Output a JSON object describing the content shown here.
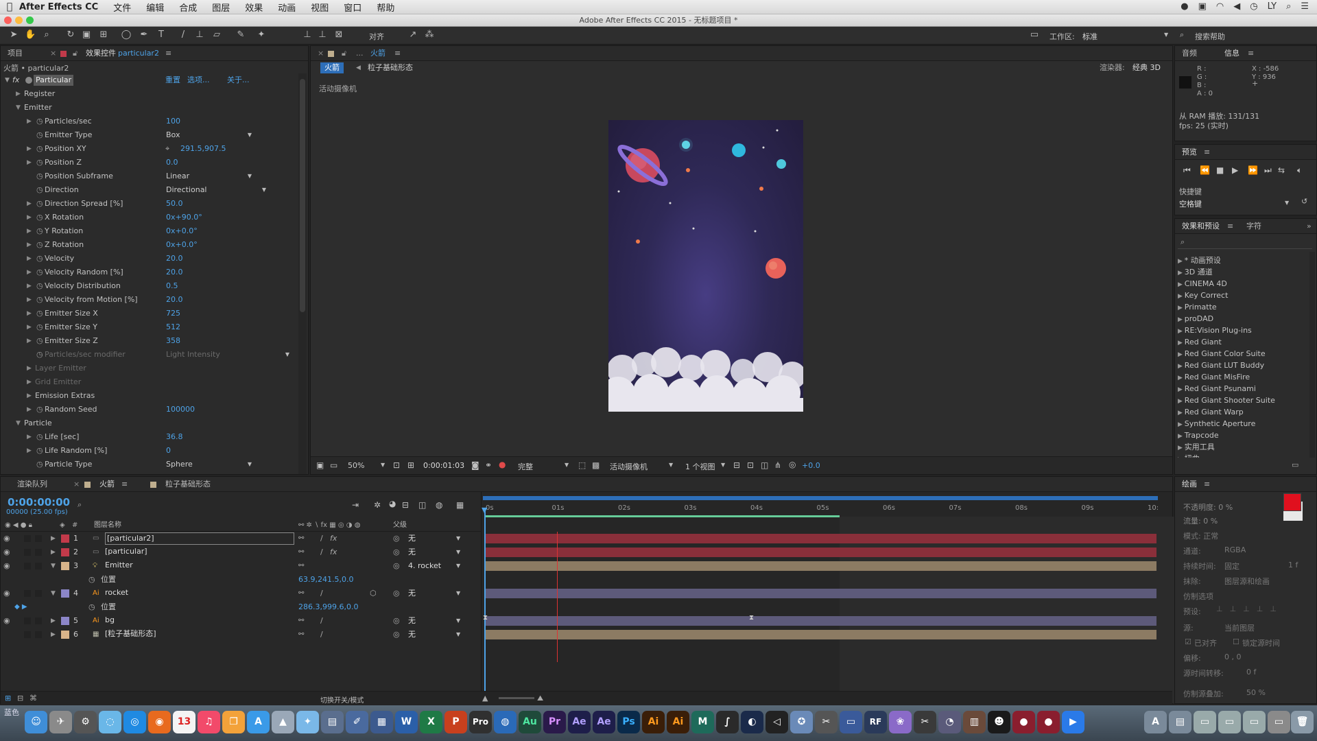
{
  "menubar": {
    "app": "After Effects CC",
    "items": [
      "文件",
      "编辑",
      "合成",
      "图层",
      "效果",
      "动画",
      "视图",
      "窗口",
      "帮助"
    ],
    "user": "LY"
  },
  "window_title": "Adobe After Effects CC 2015 - 无标题项目 *",
  "toolbar": {
    "align": "对齐",
    "workspace_label": "工作区:",
    "workspace_value": "标准",
    "search_help": "搜索帮助"
  },
  "project_panel": {
    "tab_project": "项目",
    "tab_effect_controls": "效果控件",
    "layer": "particular2",
    "breadcrumb": "火箭 • particular2",
    "effect": "Particular",
    "reset": "重置",
    "options": "选项...",
    "about": "关于..."
  },
  "props": [
    {
      "name": "Register",
      "level": 1,
      "type": "group"
    },
    {
      "name": "Emitter",
      "level": 1,
      "type": "group_open"
    },
    {
      "name": "Particles/sec",
      "level": 2,
      "val": "100"
    },
    {
      "name": "Emitter Type",
      "level": 2,
      "dd": "Box"
    },
    {
      "name": "Position XY",
      "level": 2,
      "val": "291.5,907.5",
      "pos": true
    },
    {
      "name": "Position Z",
      "level": 2,
      "val": "0.0"
    },
    {
      "name": "Position Subframe",
      "level": 2,
      "dd": "Linear"
    },
    {
      "name": "Direction",
      "level": 2,
      "dd": "Directional"
    },
    {
      "name": "Direction Spread [%]",
      "level": 2,
      "val": "50.0"
    },
    {
      "name": "X Rotation",
      "level": 2,
      "val": "0x+90.0°"
    },
    {
      "name": "Y Rotation",
      "level": 2,
      "val": "0x+0.0°"
    },
    {
      "name": "Z Rotation",
      "level": 2,
      "val": "0x+0.0°"
    },
    {
      "name": "Velocity",
      "level": 2,
      "val": "20.0"
    },
    {
      "name": "Velocity Random [%]",
      "level": 2,
      "val": "20.0"
    },
    {
      "name": "Velocity Distribution",
      "level": 2,
      "val": "0.5"
    },
    {
      "name": "Velocity from Motion [%]",
      "level": 2,
      "val": "20.0"
    },
    {
      "name": "Emitter Size X",
      "level": 2,
      "val": "725"
    },
    {
      "name": "Emitter Size Y",
      "level": 2,
      "val": "512"
    },
    {
      "name": "Emitter Size Z",
      "level": 2,
      "val": "358"
    },
    {
      "name": "Particles/sec modifier",
      "level": 2,
      "dd": "Light Intensity",
      "dim": true
    },
    {
      "name": "Layer Emitter",
      "level": 2,
      "type": "group",
      "dim": true
    },
    {
      "name": "Grid Emitter",
      "level": 2,
      "type": "group",
      "dim": true
    },
    {
      "name": "Emission Extras",
      "level": 2,
      "type": "group"
    },
    {
      "name": "Random Seed",
      "level": 2,
      "val": "100000"
    },
    {
      "name": "Particle",
      "level": 1,
      "type": "group_open"
    },
    {
      "name": "Life [sec]",
      "level": 2,
      "val": "36.8"
    },
    {
      "name": "Life Random [%]",
      "level": 2,
      "val": "0"
    },
    {
      "name": "Particle Type",
      "level": 2,
      "dd": "Sphere"
    }
  ],
  "comp_panel": {
    "tab": "火箭",
    "breadcrumb_a": "火箭",
    "breadcrumb_b": "粒子基础形态",
    "renderer_label": "渲染器:",
    "renderer": "经典 3D",
    "camera_label": "活动摄像机",
    "zoom": "50%",
    "timecode": "0:00:01:03",
    "quality": "完整",
    "camera": "活动摄像机",
    "views": "1 个视图",
    "exposure": "+0.0"
  },
  "info_panel": {
    "tab_audio": "音频",
    "tab_info": "信息",
    "r": "R :",
    "g": "G :",
    "b": "B :",
    "a": "A : 0",
    "x": "X : -586",
    "y": "Y : 936",
    "ram": "从 RAM 播放: 131/131",
    "fps": "fps: 25 (实时)"
  },
  "preview": {
    "title": "预览",
    "shortcut_label": "快捷键",
    "shortcut": "空格键"
  },
  "effects_presets": {
    "tab": "效果和预设",
    "tab_char": "字符",
    "items": [
      "* 动画预设",
      "3D 通道",
      "CINEMA 4D",
      "Key Correct",
      "Primatte",
      "proDAD",
      "RE:Vision Plug-ins",
      "Red Giant",
      "Red Giant Color Suite",
      "Red Giant LUT Buddy",
      "Red Giant MisFire",
      "Red Giant Psunami",
      "Red Giant Shooter Suite",
      "Red Giant Warp",
      "Synthetic Aperture",
      "Trapcode",
      "实用工具",
      "扭曲"
    ]
  },
  "paint": {
    "title": "绘画",
    "opacity": "不透明度: 0 %",
    "flow": "流量: 0 %",
    "mode": "模式: 正常",
    "channel": "通道:",
    "channel_val": "RGBA",
    "duration": "持续时间:",
    "duration_val": "固定",
    "erase": "抹除:",
    "erase_val": "图层源和绘画",
    "clone": "仿制选项",
    "preset": "预设:",
    "source": "源:",
    "source_val": "当前图层",
    "aligned": "已对齐",
    "lock_time": "锁定源时间",
    "offset": "偏移:",
    "offset_val": "0 ,      0",
    "time_shift": "源时间转移:",
    "time_shift_val": "0 f",
    "clone_overlay": "仿制源叠加:",
    "clone_overlay_val": "50 %",
    "brush_num": "1 f"
  },
  "timeline": {
    "tab_render": "渲染队列",
    "tab_rocket": "火箭",
    "tab_particle": "粒子基础形态",
    "timecode": "0:00:00:00",
    "frames": "00000 (25.00 fps)",
    "col_name": "图层名称",
    "col_parent": "父级",
    "toggle": "切换开关/模式",
    "ticks": [
      "0s",
      "01s",
      "02s",
      "03s",
      "04s",
      "05s",
      "06s",
      "07s",
      "08s",
      "09s",
      "10:"
    ],
    "layers": [
      {
        "num": "1",
        "name": "[particular2]",
        "color": "#c23a4a",
        "bar": "#8a2f3a",
        "parent": "无",
        "fx": true,
        "selected": true
      },
      {
        "num": "2",
        "name": "[particular]",
        "color": "#c23a4a",
        "bar": "#8a2f3a",
        "parent": "无",
        "fx": true
      },
      {
        "num": "3",
        "name": "Emitter",
        "color": "#d8b48a",
        "bar": "#8c7b63",
        "parent": "4. rocket",
        "open": true,
        "light": true
      },
      {
        "sub": true,
        "name": "位置",
        "val": "63.9,241.5,0.0"
      },
      {
        "num": "4",
        "name": "rocket",
        "color": "#8c86c8",
        "bar": "#5d5a7a",
        "parent": "无",
        "open": true,
        "ai": true
      },
      {
        "sub": true,
        "name": "位置",
        "val": "286.3,999.6,0.0",
        "kf": true
      },
      {
        "num": "5",
        "name": "bg",
        "color": "#8c86c8",
        "bar": "#5d5a7a",
        "parent": "无",
        "ai": true
      },
      {
        "num": "6",
        "name": "[粒子基础形态]",
        "color": "#d8b48a",
        "bar": "#8c7b63",
        "parent": "无",
        "comp": true
      }
    ]
  },
  "dock": {
    "label": "蓝色"
  }
}
